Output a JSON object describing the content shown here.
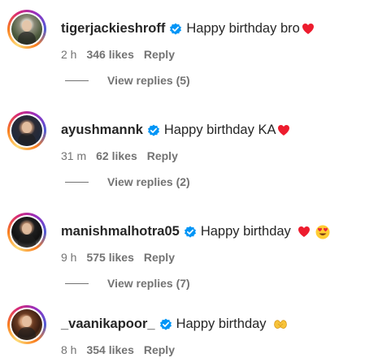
{
  "comments": [
    {
      "username": "tigerjackieshroff",
      "text": "Happy birthday bro",
      "time": "2 h",
      "likes": "346 likes",
      "reply": "Reply",
      "view_replies": "View replies (5)",
      "avatar_icon": "profile-photo"
    },
    {
      "username": "ayushmannk",
      "text": "Happy birthday KA",
      "time": "31 m",
      "likes": "62 likes",
      "reply": "Reply",
      "view_replies": "View replies (2)",
      "avatar_icon": "profile-photo"
    },
    {
      "username": "manishmalhotra05",
      "text": "Happy birthday",
      "time": "9 h",
      "likes": "575 likes",
      "reply": "Reply",
      "view_replies": "View replies (7)",
      "avatar_icon": "profile-photo"
    },
    {
      "username": "_vaanikapoor_",
      "text": "Happy birthday",
      "time": "8 h",
      "likes": "354 likes",
      "reply": "Reply",
      "avatar_icon": "profile-photo"
    }
  ],
  "colors": {
    "verified": "#0095f6",
    "heart": "#ed1c2e",
    "meta": "#737373",
    "text": "#262626"
  },
  "icons": [
    "verified-badge-icon",
    "red-heart-icon",
    "heart-eyes-emoji-icon",
    "heart-hands-emoji-icon"
  ]
}
